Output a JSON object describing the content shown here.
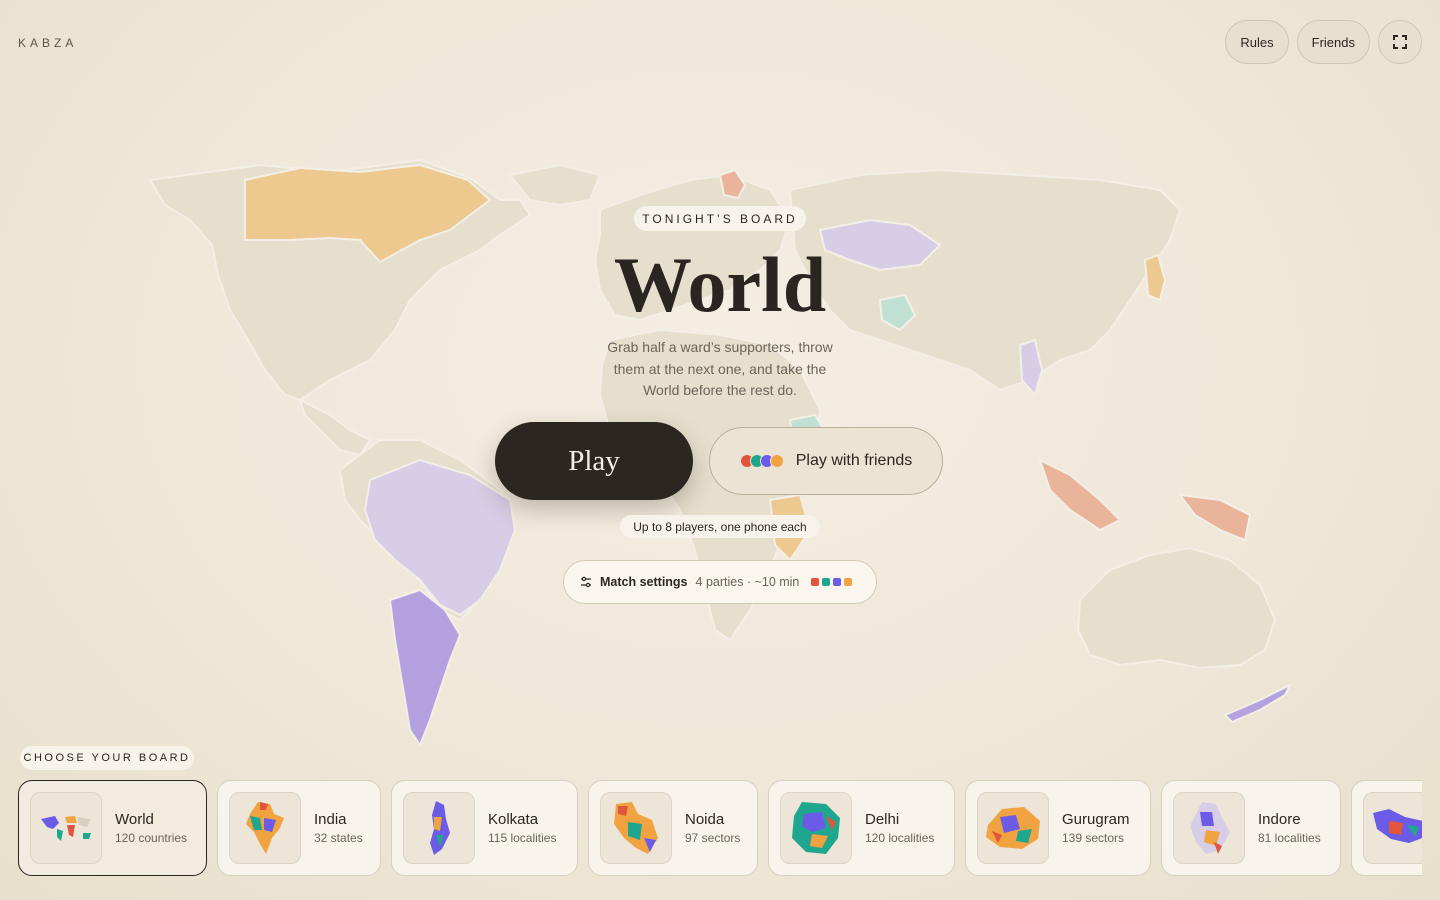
{
  "brand": "KABZA",
  "top_actions": {
    "rules": "Rules",
    "friends": "Friends"
  },
  "hero": {
    "eyebrow": "TONIGHT’S BOARD",
    "title": "World",
    "subtitle": "Grab half a ward’s supporters, throw them at the next one, and take the World before the rest do.",
    "play": "Play",
    "play_with_friends": "Play with friends",
    "players_note": "Up to 8 players, one phone each"
  },
  "match_settings": {
    "label": "Match settings",
    "detail": "4 parties · ~10 min",
    "party_colors": [
      "#e0553b",
      "#1ea78e",
      "#6b5be6",
      "#f0a340"
    ]
  },
  "friend_dot_colors": [
    "#e0553b",
    "#1ea78e",
    "#6b5be6",
    "#f0a340"
  ],
  "choose_label": "CHOOSE YOUR BOARD",
  "boards": [
    {
      "name": "World",
      "meta": "120 countries",
      "selected": true
    },
    {
      "name": "India",
      "meta": "32 states"
    },
    {
      "name": "Kolkata",
      "meta": "115 localities"
    },
    {
      "name": "Noida",
      "meta": "97 sectors"
    },
    {
      "name": "Delhi",
      "meta": "120 localities"
    },
    {
      "name": "Gurugram",
      "meta": "139 sectors"
    },
    {
      "name": "Indore",
      "meta": "81 localities"
    }
  ],
  "map_party_colors": {
    "orange": "#edc98f",
    "lavender": "#d8cde6",
    "purple": "#b4a2e0",
    "salmon": "#eab49a",
    "teal": "#bfe0d2"
  }
}
